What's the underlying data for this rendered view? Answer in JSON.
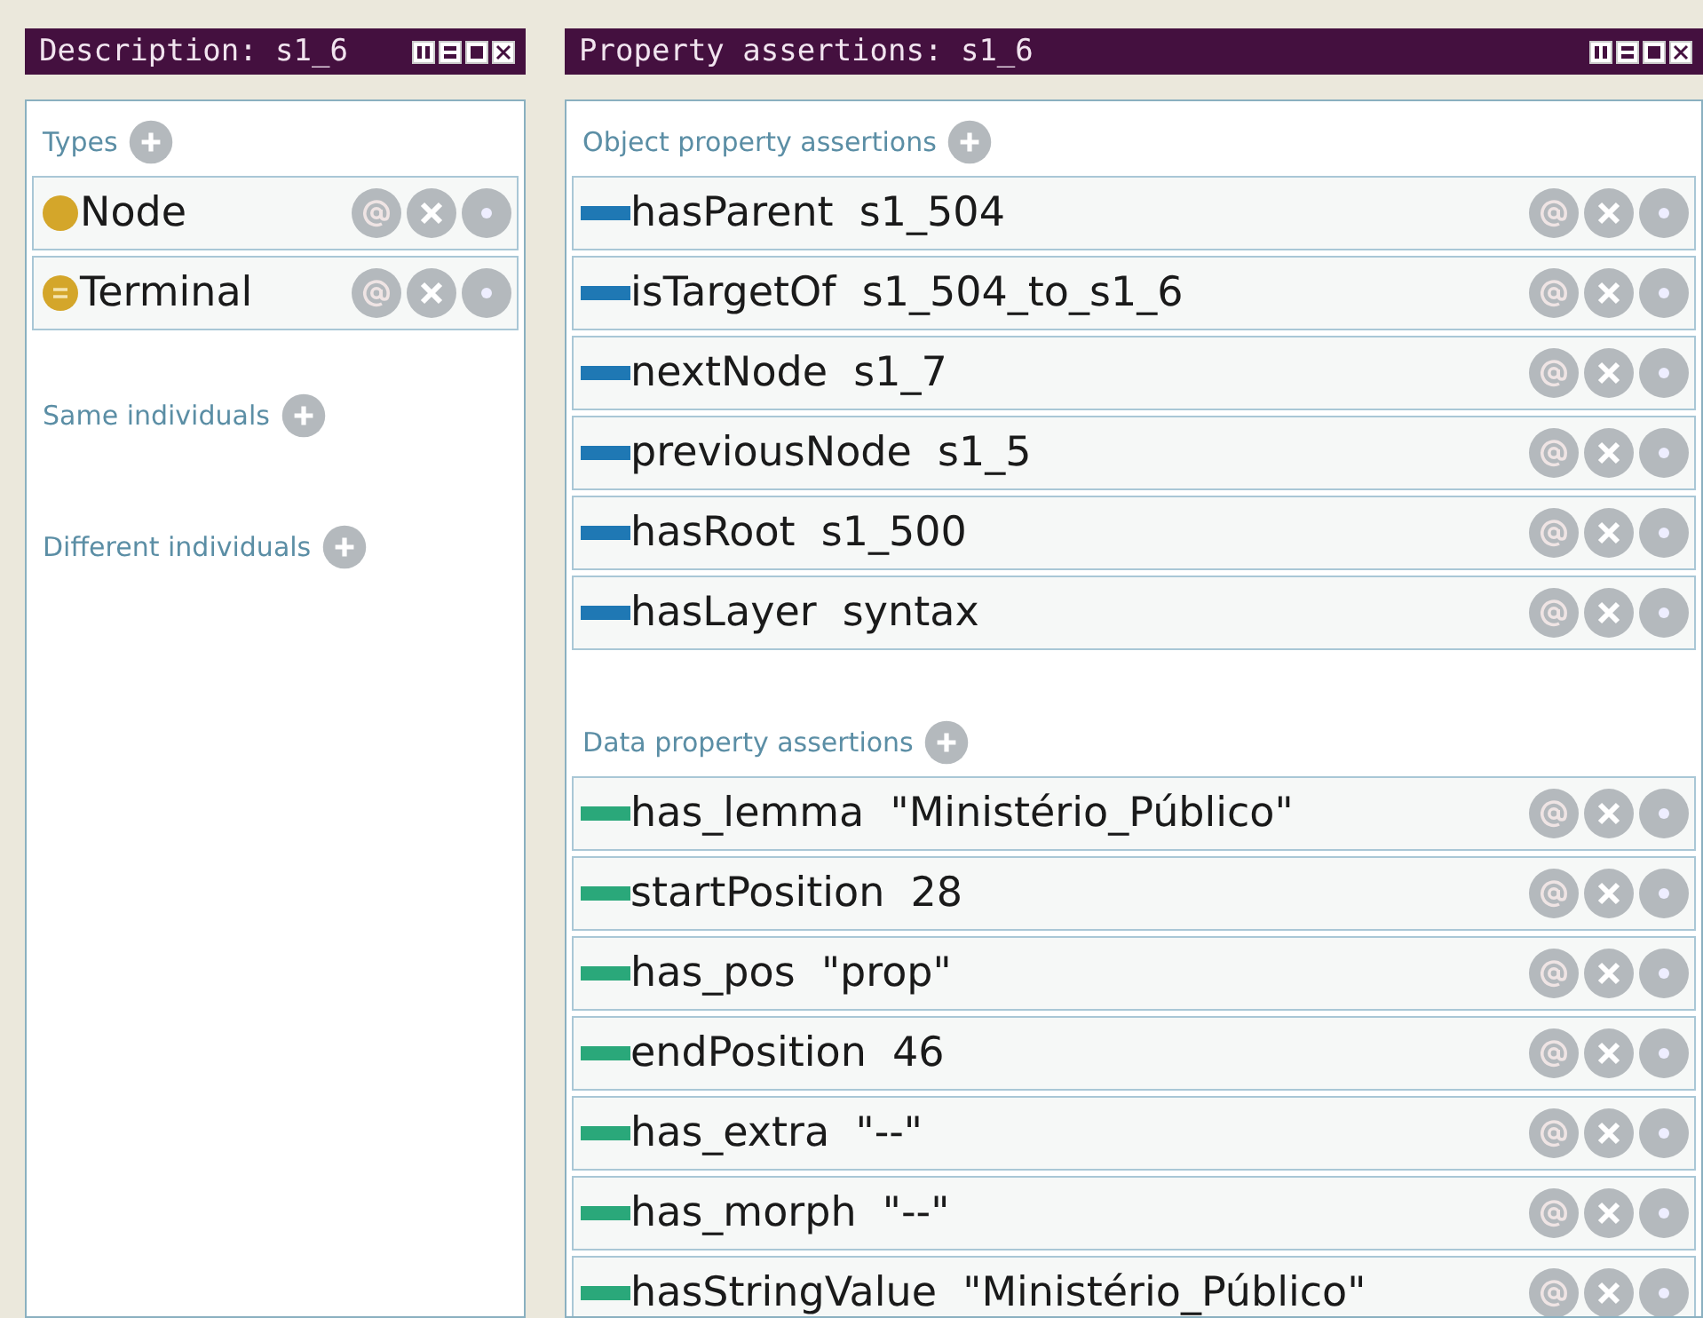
{
  "description_panel": {
    "title": "Description: s1_6",
    "sections": [
      {
        "label": "Types",
        "items": [
          {
            "name": "Node",
            "kind": "primitive"
          },
          {
            "name": "Terminal",
            "kind": "defined"
          }
        ]
      },
      {
        "label": "Same individuals"
      },
      {
        "label": "Different individuals"
      }
    ]
  },
  "assertions_panel": {
    "title": "Property assertions: s1_6",
    "sections": [
      {
        "label": "Object property assertions",
        "color": "#1f78b4",
        "items": [
          {
            "property": "hasParent",
            "value": "s1_504"
          },
          {
            "property": "isTargetOf",
            "value": "s1_504_to_s1_6"
          },
          {
            "property": "nextNode",
            "value": "s1_7"
          },
          {
            "property": "previousNode",
            "value": "s1_5"
          },
          {
            "property": "hasRoot",
            "value": "s1_500"
          },
          {
            "property": "hasLayer",
            "value": "syntax"
          }
        ]
      },
      {
        "label": "Data property assertions",
        "color": "#2aa87a",
        "items": [
          {
            "property": "has_lemma",
            "value": "\"Ministério_Público\""
          },
          {
            "property": "startPosition",
            "value": "28"
          },
          {
            "property": "has_pos",
            "value": "\"prop\""
          },
          {
            "property": "endPosition",
            "value": "46"
          },
          {
            "property": "has_extra",
            "value": "\"--\""
          },
          {
            "property": "has_morph",
            "value": "\"--\""
          },
          {
            "property": "hasStringValue",
            "value": "\"Ministério_Público\""
          }
        ]
      }
    ]
  }
}
